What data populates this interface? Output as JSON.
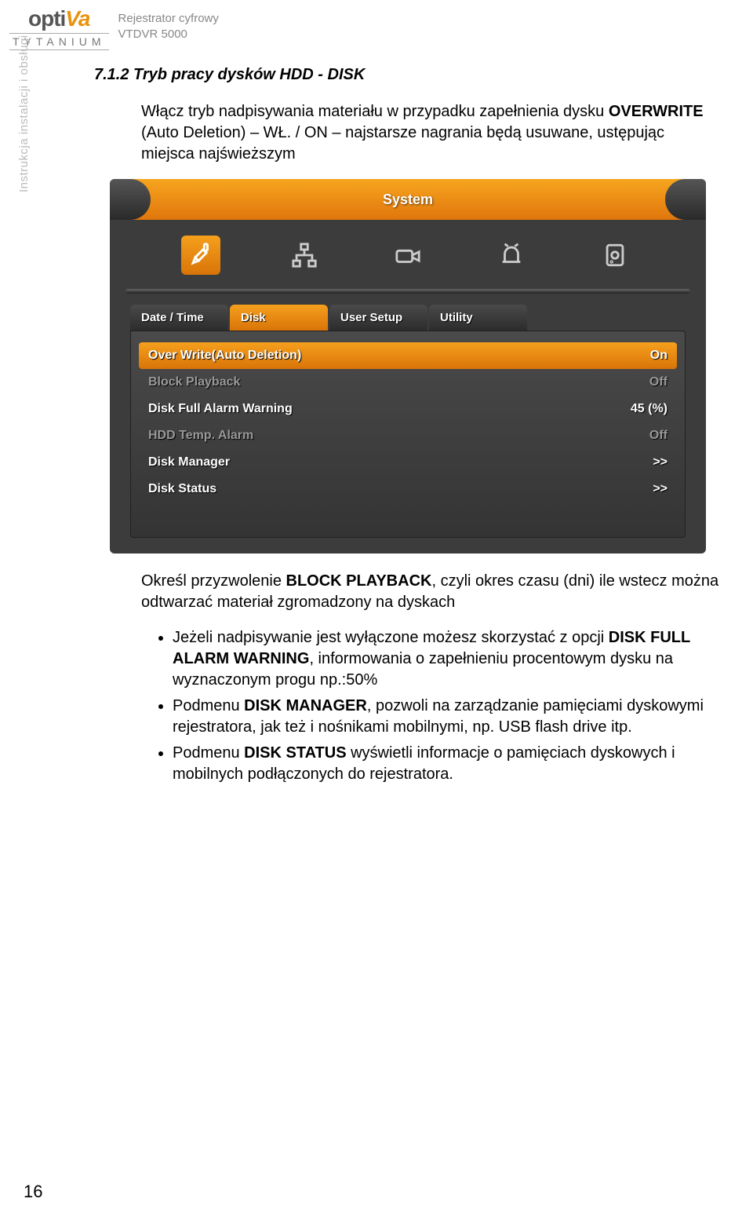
{
  "header": {
    "logo_main": "opti",
    "logo_accent": "Va",
    "logo_sub": "TYTANIUM",
    "doc_line1": "Rejestrator cyfrowy",
    "doc_line2": "VTDVR 5000"
  },
  "sidebar_text": "Instrukcja instalacji i obsługi",
  "section_title": "7.1.2  Tryb pracy dysków HDD - DISK",
  "intro_pre": "Włącz tryb nadpisywania materiału w przypadku zapełnienia dysku ",
  "intro_bold": "OVERWRITE",
  "intro_post": " (Auto Deletion) – WŁ. / ON – najstarsze nagrania będą usuwane, ustępując miejsca najświeższym",
  "screenshot": {
    "title": "System",
    "icons": [
      "tools-icon",
      "network-icon",
      "camera-icon",
      "alarm-icon",
      "hdd-icon"
    ],
    "active_icon_index": 0,
    "tabs": [
      "Date / Time",
      "Disk",
      "User Setup",
      "Utility"
    ],
    "active_tab_index": 1,
    "rows": [
      {
        "label": "Over Write(Auto Deletion)",
        "value": "On",
        "highlight": true
      },
      {
        "label": "Block Playback",
        "value": "Off",
        "dim": true
      },
      {
        "label": "Disk Full Alarm Warning",
        "value": "45 (%)"
      },
      {
        "label": "HDD Temp. Alarm",
        "value": "Off",
        "dim": true
      },
      {
        "label": "Disk Manager",
        "value": ">>"
      },
      {
        "label": "Disk Status",
        "value": ">>"
      }
    ]
  },
  "post_pre": "Określ przyzwolenie ",
  "post_bold": "BLOCK PLAYBACK",
  "post_post": ", czyli okres czasu (dni) ile wstecz można odtwarzać materiał zgromadzony na dyskach",
  "bullets": [
    {
      "pre": "Jeżeli nadpisywanie jest wyłączone możesz skorzystać z opcji ",
      "bold": "DISK FULL ALARM WARNING",
      "post": ", informowania o zapełnieniu procentowym dysku na wyznaczonym progu np.:50%"
    },
    {
      "pre": "Podmenu ",
      "bold": "DISK MANAGER",
      "post": ", pozwoli na zarządzanie pamięciami dyskowymi rejestratora, jak też i nośnikami mobilnymi, np. USB flash drive itp."
    },
    {
      "pre": "Podmenu ",
      "bold": "DISK STATUS",
      "post": " wyświetli informacje o pamięciach dyskowych i mobilnych podłączonych do rejestratora."
    }
  ],
  "page_number": "16"
}
